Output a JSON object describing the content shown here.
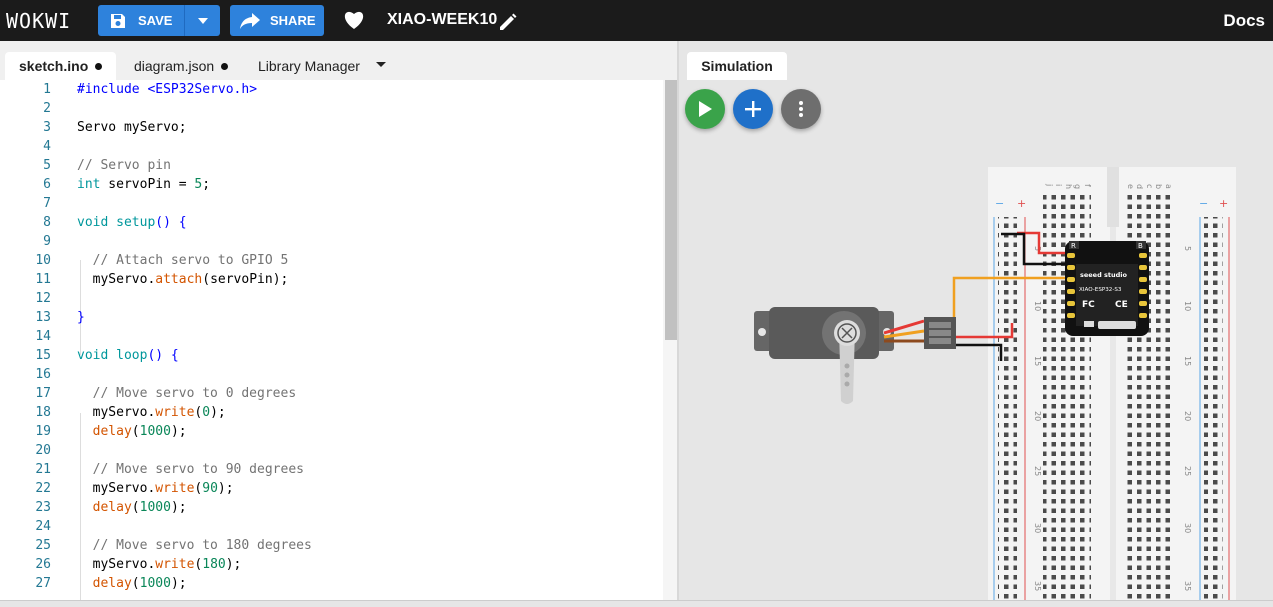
{
  "header": {
    "logo": "WOKWI",
    "save_label": "SAVE",
    "share_label": "SHARE",
    "project_name": "XIAO-WEEK10",
    "docs_label": "Docs"
  },
  "editor": {
    "tabs": [
      {
        "label": "sketch.ino",
        "modified": true
      },
      {
        "label": "diagram.json",
        "modified": true
      },
      {
        "label": "Library Manager"
      }
    ],
    "line_numbers": [
      "1",
      "2",
      "3",
      "4",
      "5",
      "6",
      "7",
      "8",
      "9",
      "10",
      "11",
      "12",
      "13",
      "14",
      "15",
      "16",
      "17",
      "18",
      "19",
      "20",
      "21",
      "22",
      "23",
      "24",
      "25",
      "26",
      "27"
    ],
    "code": {
      "l1_a": "#include ",
      "l1_b": "<ESP32Servo.h>",
      "l3": "Servo myServo;",
      "l5": "// Servo pin",
      "l6_a": "int",
      "l6_b": " servoPin = ",
      "l6_c": "5",
      "l6_d": ";",
      "l8_a": "void",
      "l8_b": " ",
      "l8_c": "setup",
      "l8_d": "() {",
      "l10": "  // Attach servo to GPIO 5",
      "l11_a": "  myServo.",
      "l11_b": "attach",
      "l11_c": "(servoPin);",
      "l13": "}",
      "l15_a": "void",
      "l15_b": " ",
      "l15_c": "loop",
      "l15_d": "() {",
      "l17": "  // Move servo to 0 degrees",
      "l18_a": "  myServo.",
      "l18_b": "write",
      "l18_c": "(",
      "l18_d": "0",
      "l18_e": ");",
      "l19_a": "  ",
      "l19_b": "delay",
      "l19_c": "(",
      "l19_d": "1000",
      "l19_e": ");",
      "l21": "  // Move servo to 90 degrees",
      "l22_a": "  myServo.",
      "l22_b": "write",
      "l22_c": "(",
      "l22_d": "90",
      "l22_e": ");",
      "l23_a": "  ",
      "l23_b": "delay",
      "l23_c": "(",
      "l23_d": "1000",
      "l23_e": ");",
      "l25": "  // Move servo to 180 degrees",
      "l26_a": "  myServo.",
      "l26_b": "write",
      "l26_c": "(",
      "l26_d": "180",
      "l26_e": ");",
      "l27_a": "  ",
      "l27_b": "delay",
      "l27_c": "(",
      "l27_d": "1000",
      "l27_e": ");"
    }
  },
  "simulation": {
    "tab_label": "Simulation",
    "board_brand": "seeed studio",
    "board_model": "XIAO-ESP32-S3",
    "board_pin_r": "R",
    "board_pin_b": "B",
    "breadboard_rows": [
      "5",
      "10",
      "15",
      "20",
      "25",
      "30",
      "35"
    ],
    "breadboard_cols_left": [
      "j",
      "i",
      "h",
      "g",
      "f"
    ],
    "breadboard_cols_right": [
      "e",
      "d",
      "c",
      "b",
      "a"
    ],
    "rail_plus": "+",
    "rail_minus": "−"
  },
  "colors": {
    "topbar": "#1b1b1b",
    "button_blue": "#2e82dc",
    "play_green": "#3aa34a",
    "add_blue": "#1f70c9",
    "menu_gray": "#6e6e6e"
  },
  "icons": [
    "save-icon",
    "dropdown-icon",
    "share-icon",
    "heart-icon",
    "pencil-icon",
    "play-icon",
    "plus-icon",
    "more-vertical-icon"
  ]
}
